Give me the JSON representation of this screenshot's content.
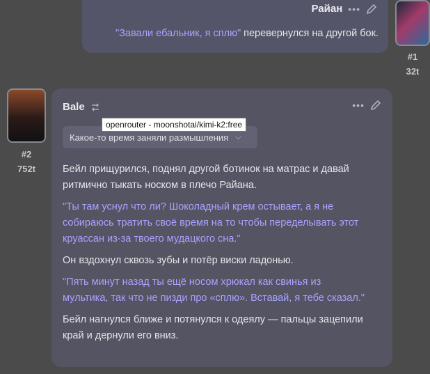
{
  "user_message": {
    "name": "Райан",
    "quote": "\"Завали ебальник, я сплю\"",
    "text": " перевернулся на другой бок.",
    "index": "#1",
    "tokens": "32t"
  },
  "bot_message": {
    "name": "Bale",
    "index": "#2",
    "tokens": "752t",
    "tooltip": "openrouter - moonshotai/kimi-k2:free",
    "reasoning_label": "Какое-то время заняли размышления",
    "paragraphs": [
      {
        "text": "Бейл прищурился, поднял другой ботинок на матрас и давай ритмично тыкать носком в плечо Райана.",
        "quote": false
      },
      {
        "text": "\"Ты там уснул что ли? Шоколадный крем остывает, а я не собираюсь тратить своё время на то чтобы переделывать этот круассан из-за твоего мудацкого сна.\"",
        "quote": true
      },
      {
        "text": "Он вздохнул сквозь зубы и потёр виски ладонью.",
        "quote": false
      },
      {
        "text": "\"Пять минут назад ты ещё носом хрюкал как свинья из мультика, так что не пизди про «сплю». Вставай, я тебе сказал.\"",
        "quote": true
      },
      {
        "text": "Бейл нагнулся ближе и потянулся к одеялу — пальцы зацепили край и дернули его вниз.",
        "quote": false
      }
    ]
  },
  "icons": [
    "more-dots-icon",
    "edit-pencil-icon",
    "swipe-arrows-icon",
    "chevron-down-icon"
  ],
  "colors": {
    "background": "#4a4b4a",
    "bubble": "#545463",
    "quote": "#a9a3ff"
  }
}
